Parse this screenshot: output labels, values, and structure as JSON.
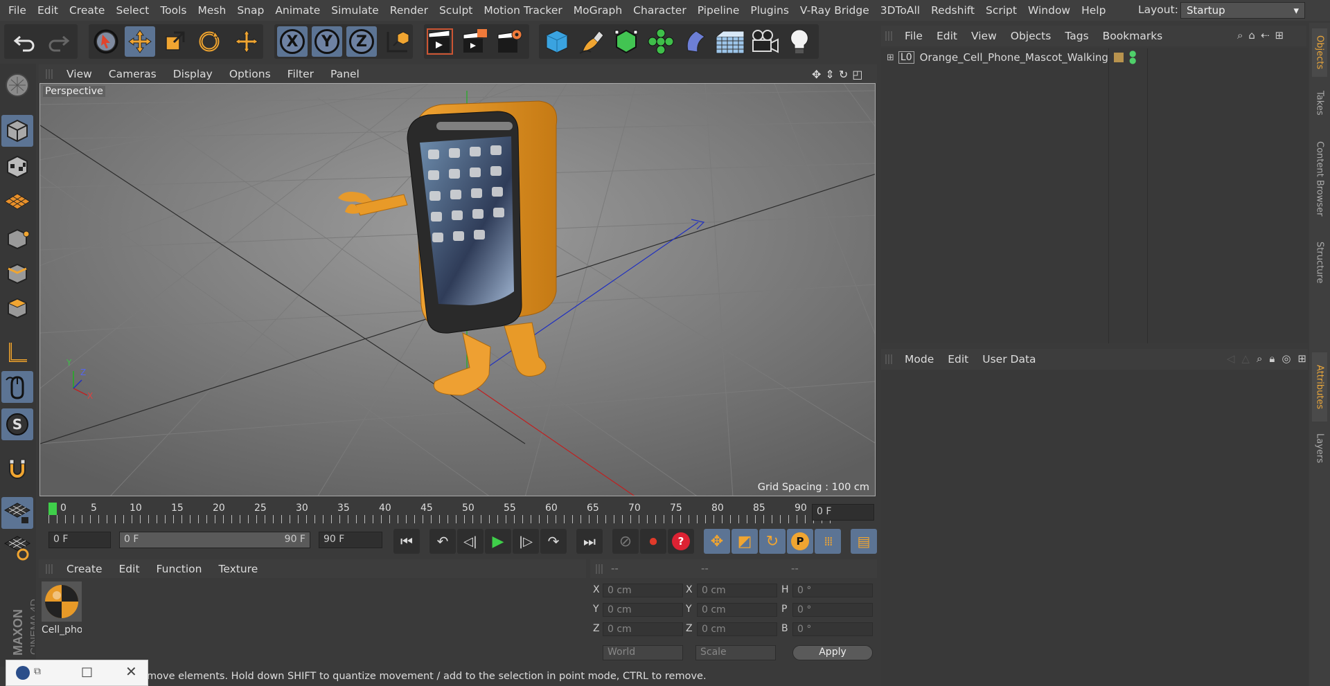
{
  "menubar": {
    "items": [
      "File",
      "Edit",
      "Create",
      "Select",
      "Tools",
      "Mesh",
      "Snap",
      "Animate",
      "Simulate",
      "Render",
      "Sculpt",
      "Motion Tracker",
      "MoGraph",
      "Character",
      "Pipeline",
      "Plugins",
      "V-Ray Bridge",
      "3DToAll",
      "Redshift",
      "Script",
      "Window",
      "Help"
    ],
    "layout_label": "Layout:",
    "layout_value": "Startup"
  },
  "viewport": {
    "menu": [
      "View",
      "Cameras",
      "Display",
      "Options",
      "Filter",
      "Panel"
    ],
    "label": "Perspective",
    "grid_spacing": "Grid Spacing : 100 cm",
    "axis_labels": {
      "y": "Y",
      "z": "Z",
      "x": "X"
    }
  },
  "timeline": {
    "ticks": [
      "0",
      "5",
      "10",
      "15",
      "20",
      "25",
      "30",
      "35",
      "40",
      "45",
      "50",
      "55",
      "60",
      "65",
      "70",
      "75",
      "80",
      "85",
      "90"
    ],
    "current_frame": "0 F",
    "start_field": "0 F",
    "range_min": "0 F",
    "range_max": "90 F",
    "end_field": "90 F"
  },
  "material_manager": {
    "menu": [
      "Create",
      "Edit",
      "Function",
      "Texture"
    ],
    "material_name": "Cell_pho"
  },
  "coordinates": {
    "headers": [
      "--",
      "--",
      "--"
    ],
    "rows": [
      {
        "l1": "X",
        "v1": "0 cm",
        "l2": "X",
        "v2": "0 cm",
        "l3": "H",
        "v3": "0 °"
      },
      {
        "l1": "Y",
        "v1": "0 cm",
        "l2": "Y",
        "v2": "0 cm",
        "l3": "P",
        "v3": "0 °"
      },
      {
        "l1": "Z",
        "v1": "0 cm",
        "l2": "Z",
        "v2": "0 cm",
        "l3": "B",
        "v3": "0 °"
      }
    ],
    "world": "World",
    "scale": "Scale",
    "apply": "Apply"
  },
  "status": {
    "text": "move elements. Hold down SHIFT to quantize movement / add to the selection in point mode, CTRL to remove."
  },
  "object_manager": {
    "menu": [
      "File",
      "Edit",
      "View",
      "Objects",
      "Tags",
      "Bookmarks"
    ],
    "object_name": "Orange_Cell_Phone_Mascot_Walking"
  },
  "attribute_manager": {
    "menu": [
      "Mode",
      "Edit",
      "User Data"
    ]
  },
  "side_tabs": [
    "Objects",
    "Takes",
    "Content Browser",
    "Structure",
    "Attributes",
    "Layers"
  ],
  "brand": {
    "line1": "MAXON",
    "line2": "CINEMA 4D"
  },
  "colors": {
    "accent": "#5c7494",
    "orange": "#e8a53a",
    "play": "#3fcf4a"
  }
}
